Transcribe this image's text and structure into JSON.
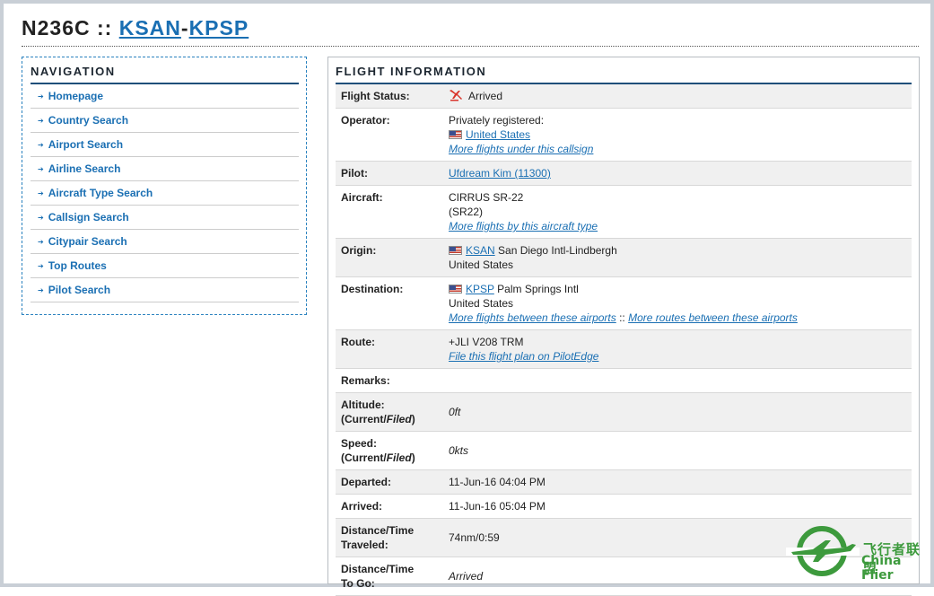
{
  "header": {
    "callsign": "N236C",
    "separator": " :: ",
    "origin_code": "KSAN",
    "dash": "-",
    "destination_code": "KPSP"
  },
  "navigation": {
    "heading": "NAVIGATION",
    "items": [
      {
        "label": "Homepage"
      },
      {
        "label": "Country Search"
      },
      {
        "label": "Airport Search"
      },
      {
        "label": "Airline Search"
      },
      {
        "label": "Aircraft Type Search"
      },
      {
        "label": "Callsign Search"
      },
      {
        "label": "Citypair Search"
      },
      {
        "label": "Top Routes"
      },
      {
        "label": "Pilot Search"
      }
    ]
  },
  "flight_info": {
    "heading": "FLIGHT INFORMATION",
    "status": {
      "label": "Flight Status:",
      "value": "Arrived",
      "icon": "arrived-plane-icon",
      "icon_color": "#d9342b"
    },
    "operator": {
      "label": "Operator:",
      "line1": "Privately registered:",
      "country": "United States",
      "link": "More flights under this callsign"
    },
    "pilot": {
      "label": "Pilot:",
      "value": "Ufdream Kim (11300)"
    },
    "aircraft": {
      "label": "Aircraft:",
      "line1": "CIRRUS SR-22",
      "line2": "(SR22)",
      "link": "More flights by this aircraft type"
    },
    "origin": {
      "label": "Origin:",
      "code": "KSAN",
      "name": " San Diego Intl-Lindbergh",
      "country": "United States"
    },
    "destination": {
      "label": "Destination:",
      "code": "KPSP",
      "name": " Palm Springs Intl",
      "country": "United States",
      "link1": "More flights between these airports",
      "sep": " :: ",
      "link2": "More routes between these airports"
    },
    "route": {
      "label": "Route:",
      "value": "+JLI V208 TRM",
      "link": "File this flight plan on PilotEdge"
    },
    "remarks": {
      "label": "Remarks:",
      "value": ""
    },
    "altitude": {
      "label_line1": "Altitude:",
      "label_current": "(Current/",
      "label_filed": "Filed",
      "label_close": ")",
      "value": "0ft"
    },
    "speed": {
      "label_line1": "Speed:",
      "label_current": "(Current/",
      "label_filed": "Filed",
      "label_close": ")",
      "value": "0kts"
    },
    "departed": {
      "label": "Departed:",
      "value": "11-Jun-16 04:04 PM"
    },
    "arrived": {
      "label": "Arrived:",
      "value": "11-Jun-16 05:04 PM"
    },
    "traveled": {
      "label_line1": "Distance/Time",
      "label_line2": "Traveled:",
      "value": "74nm/0:59"
    },
    "to_go": {
      "label_line1": "Distance/Time",
      "label_line2": "To Go:",
      "value": "Arrived"
    }
  },
  "watermark": {
    "cn": "飞行者联盟",
    "en": "China Flier"
  },
  "colors": {
    "accent": "#1a6fb3",
    "heading_rule": "#1f4f7a",
    "row_shade": "#f0f0f0",
    "watermark_green": "#3d9a3d"
  }
}
